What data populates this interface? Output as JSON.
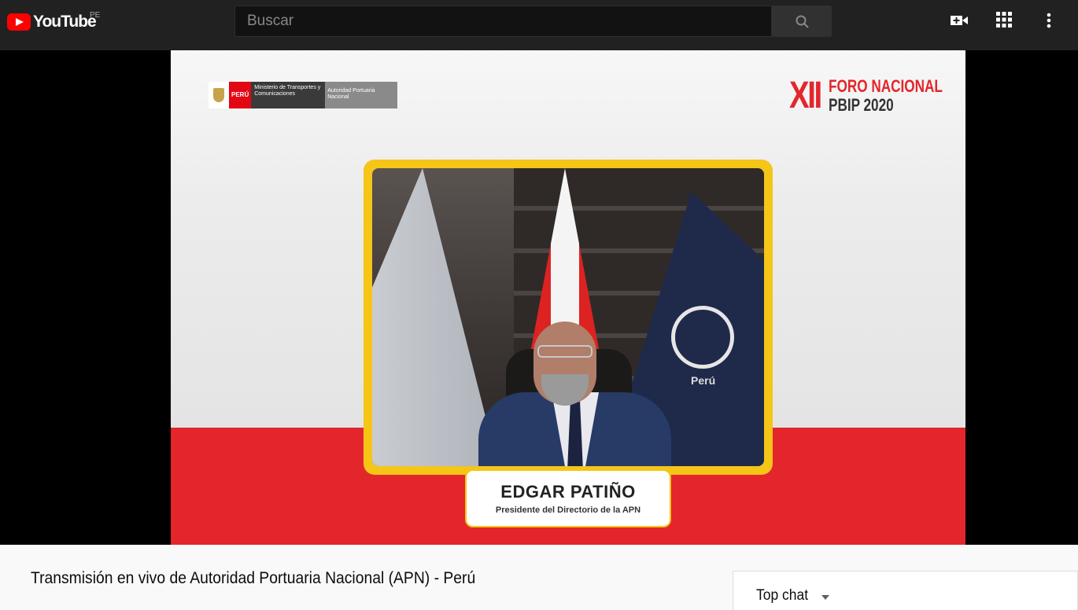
{
  "header": {
    "logo_text": "YouTube",
    "country_code": "PE",
    "search_placeholder": "Buscar",
    "icons": [
      "search-icon",
      "create-video-icon",
      "apps-grid-icon",
      "more-vert-icon"
    ]
  },
  "video": {
    "gov_peru": "PERÚ",
    "gov_ministry": "Ministerio de Transportes y Comunicaciones",
    "gov_apn": "Autoridad Portuaria Nacional",
    "event_roman": "XII",
    "event_line1": "FORO NACIONAL",
    "event_line2": "PBIP 2020",
    "flag_text": "Perú",
    "speaker_name": "EDGAR PATIÑO",
    "speaker_role": "Presidente del Directorio de la APN"
  },
  "info": {
    "title": "Transmisión en vivo de Autoridad Portuaria Nacional (APN) - Perú"
  },
  "chat": {
    "label": "Top chat"
  },
  "colors": {
    "topbar": "#212121",
    "brand_red": "#ff0000",
    "event_red": "#e3262b",
    "frame_yellow": "#f5c518"
  }
}
